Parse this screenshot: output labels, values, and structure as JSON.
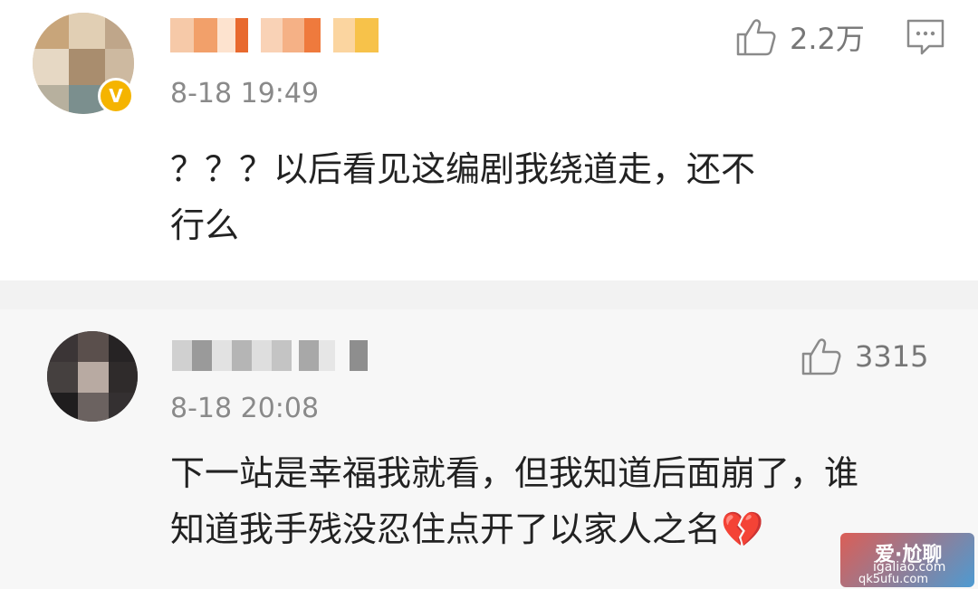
{
  "comments": [
    {
      "time": "8-18 19:49",
      "likes": "2.2万",
      "text_line1": "？？？以后看见这编剧我绕道走，还不",
      "text_line2": "行么",
      "badge": "V"
    },
    {
      "time": "8-18 20:08",
      "likes": "3315",
      "text_line1": "下一站是幸福我就看，但我知道后面崩了，谁",
      "text_line2": "知道我手残没忍住点开了以家人之名💔"
    }
  ],
  "watermark": {
    "line1": "爱·尬聊",
    "line2": "igaliao.com",
    "line3": "qk5ufu.com"
  },
  "colors": {
    "background": "#f2f2f2",
    "card": "#ffffff",
    "text": "#222222",
    "meta": "#8a8a8a",
    "badge": "#f5b400"
  },
  "icons": [
    "thumbs-up-icon",
    "reply-comment-icon",
    "verified-badge-icon",
    "broken-heart-icon"
  ]
}
